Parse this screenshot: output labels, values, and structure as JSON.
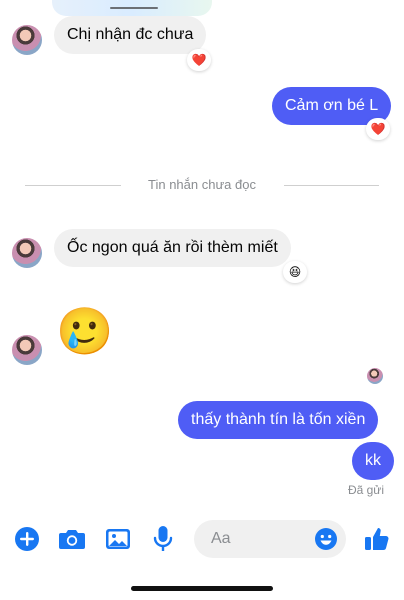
{
  "messages": {
    "incoming_1": "Chị nhận đc chưa",
    "outgoing_1": "Cảm ơn bé L",
    "incoming_2": "Ốc ngon quá ăn rồi thèm miết",
    "outgoing_2": "thấy thành tín là tốn xiền",
    "outgoing_3": "kk"
  },
  "reactions": {
    "incoming_1": "❤️",
    "outgoing_1": "❤️",
    "incoming_2": "😆"
  },
  "sticker_emoji": "🥲",
  "divider_label": "Tin nhắn chưa đọc",
  "status": "Đã gửi",
  "composer": {
    "placeholder": "Aa"
  },
  "icons": {
    "plus": "plus-circle-icon",
    "camera": "camera-icon",
    "gallery": "image-icon",
    "mic": "microphone-icon",
    "emoji": "smile-icon",
    "like": "thumbs-up-icon"
  },
  "colors": {
    "accent": "#1877f2",
    "outgoing_bubble": "#4f5df5",
    "incoming_bubble": "#f0f0f0",
    "muted_text": "#8a8d91"
  }
}
